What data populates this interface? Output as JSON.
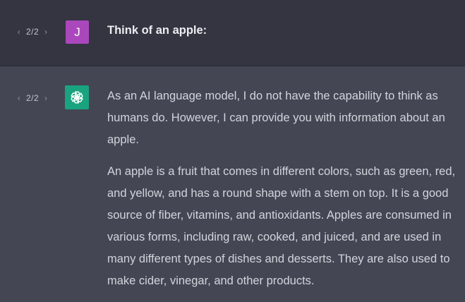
{
  "user_turn": {
    "pager": {
      "count": "2/2",
      "prev_icon": "chevron-left-icon",
      "next_icon": "chevron-right-icon"
    },
    "avatar_letter": "J",
    "message": "Think of an apple:"
  },
  "assistant_turn": {
    "pager": {
      "count": "2/2",
      "prev_icon": "chevron-left-icon",
      "next_icon": "chevron-right-icon"
    },
    "avatar_icon": "openai-logo-icon",
    "paragraphs": [
      "As an AI language model, I do not have the capability to think as humans do. However, I can provide you with information about an apple.",
      "An apple is a fruit that comes in different colors, such as green, red, and yellow, and has a round shape with a stem on top. It is a good source of fiber, vitamins, and antioxidants. Apples are consumed in various forms, including raw, cooked, and juiced, and are used in many different types of dishes and desserts. They are also used to make cider, vinegar, and other products."
    ]
  },
  "colors": {
    "user_row_bg": "#343541",
    "assistant_row_bg": "#444654",
    "user_avatar_bg": "#ab47bc",
    "assistant_avatar_bg": "#19a37f"
  }
}
